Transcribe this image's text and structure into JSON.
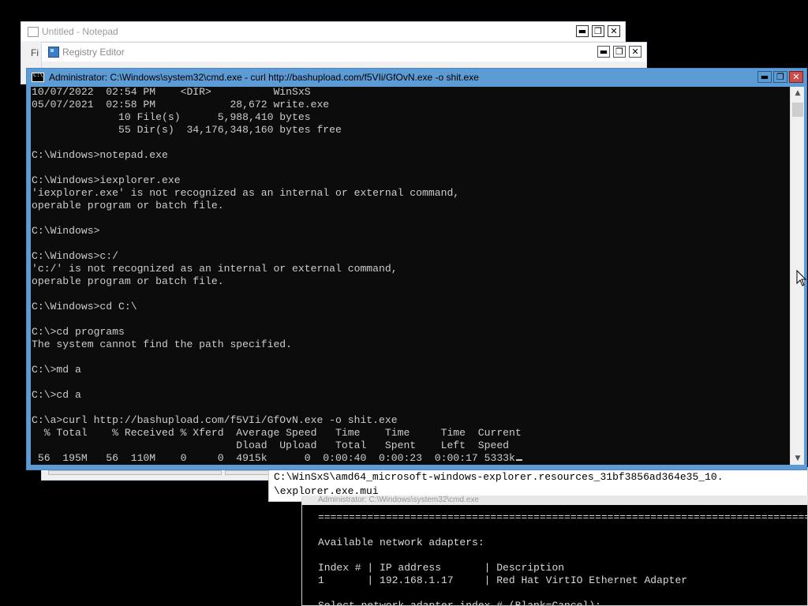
{
  "notepad": {
    "title": "Untitled - Notepad",
    "menu": "Fi"
  },
  "registry": {
    "title": "Registry Editor"
  },
  "cmd": {
    "title": "Administrator: C:\\Windows\\system32\\cmd.exe - curl  http://bashupload.com/f5VIi/GfOvN.exe -o shit.exe",
    "lines": [
      "10/07/2022  02:54 PM    <DIR>          WinSxS",
      "05/07/2021  02:58 PM            28,672 write.exe",
      "              10 File(s)      5,988,410 bytes",
      "              55 Dir(s)  34,176,348,160 bytes free",
      "",
      "C:\\Windows>notepad.exe",
      "",
      "C:\\Windows>iexplorer.exe",
      "'iexplorer.exe' is not recognized as an internal or external command,",
      "operable program or batch file.",
      "",
      "C:\\Windows>",
      "",
      "C:\\Windows>c:/",
      "'c:/' is not recognized as an internal or external command,",
      "operable program or batch file.",
      "",
      "C:\\Windows>cd C:\\",
      "",
      "C:\\>cd programs",
      "The system cannot find the path specified.",
      "",
      "C:\\>md a",
      "",
      "C:\\>cd a",
      "",
      "C:\\a>curl http://bashupload.com/f5VIi/GfOvN.exe -o shit.exe",
      "  % Total    % Received % Xferd  Average Speed   Time    Time     Time  Current",
      "                                 Dload  Upload   Total   Spent    Left  Speed",
      " 56  195M   56  110M    0     0  4915k      0  0:00:40  0:00:23  0:00:17 5333k"
    ],
    "buttons": {
      "minimize": "▬",
      "maximize": "❐",
      "close": "✕"
    }
  },
  "console2": {
    "line1": "C:\\WinSxS\\amd64_microsoft-windows-explorer.resources_31bf3856ad364e35_10.",
    "line2": "\\explorer.exe.mui"
  },
  "console3": {
    "title": "Administrator: C:\\Windows\\system32\\cmd.exe",
    "lines": [
      "================================================================================",
      "",
      "Available network adapters:",
      "",
      "Index # | IP address       | Description",
      "1       | 192.168.1.17     | Red Hat VirtIO Ethernet Adapter",
      "",
      "Select network adapter index # (Blank=Cancel):"
    ]
  },
  "colors": {
    "cmd_frame": "#5d9bd4",
    "console_bg": "#0c0c0c",
    "console_text": "#cccccc"
  }
}
